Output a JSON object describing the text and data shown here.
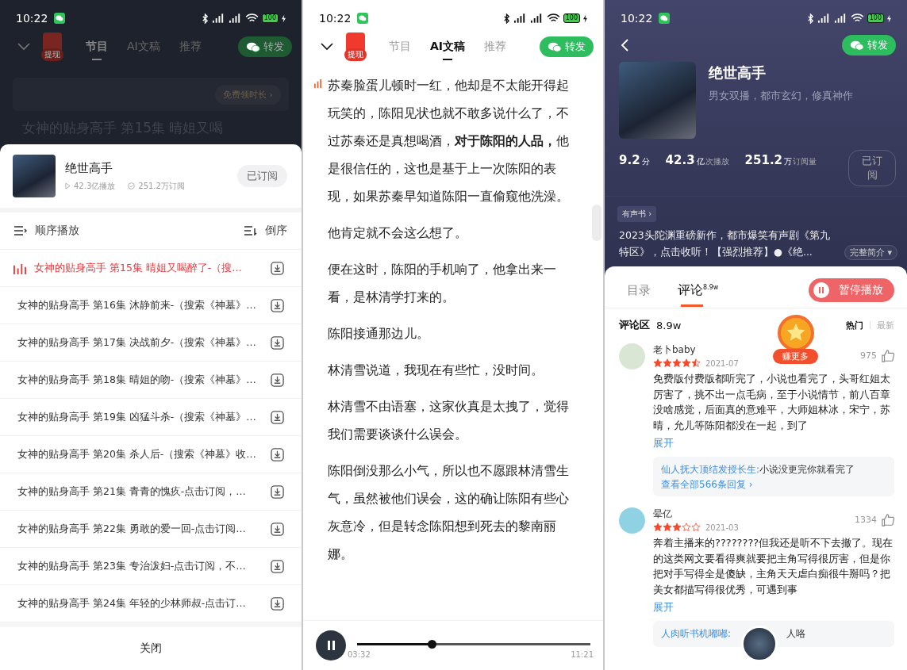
{
  "playlist_screen": {
    "status_bar": {
      "time": "10:22",
      "battery": "100"
    },
    "top_bar": {
      "badge": "提现",
      "tabs": [
        {
          "label": "节目",
          "selected": true
        },
        {
          "label": "AI文稿",
          "selected": false
        },
        {
          "label": "推荐",
          "selected": false
        }
      ],
      "share": "转发"
    },
    "backdrop": {
      "free_time_button": "免费领时长 ›",
      "episode_title": "女神的贴身高手 第15集 晴姐又喝"
    },
    "album": {
      "title": "绝世高手",
      "plays": "42.3亿播放",
      "subscriptions": "251.2万订阅",
      "subscribe_button": "已订阅",
      "subscribed": true
    },
    "sort": {
      "order": "顺序播放",
      "reverse": "倒序"
    },
    "episodes": [
      {
        "title": "女神的贴身高手 第15集 晴姐又喝醉了-（搜…",
        "playing": true
      },
      {
        "title": "女神的贴身高手 第16集 沐静前来-（搜索《神墓》…",
        "playing": false
      },
      {
        "title": "女神的贴身高手 第17集 决战前夕-（搜索《神墓》…",
        "playing": false
      },
      {
        "title": "女神的贴身高手 第18集 晴姐的吻-（搜索《神墓》…",
        "playing": false
      },
      {
        "title": "女神的贴身高手 第19集 凶猛斗杀-（搜索《神墓》…",
        "playing": false
      },
      {
        "title": "女神的贴身高手 第20集 杀人后-（搜索《神墓》收…",
        "playing": false
      },
      {
        "title": "女神的贴身高手 第21集 青青的愧疚-点击订阅，…",
        "playing": false
      },
      {
        "title": "女神的贴身高手 第22集 勇敢的爱一回-点击订阅…",
        "playing": false
      },
      {
        "title": "女神的贴身高手 第23集 专治泼妇-点击订阅，不…",
        "playing": false
      },
      {
        "title": "女神的贴身高手 第24集 年轻的少林师叔-点击订…",
        "playing": false
      }
    ],
    "close_button": "关闭"
  },
  "transcript_screen": {
    "status_bar": {
      "time": "10:22",
      "battery": "100"
    },
    "top_bar": {
      "badge": "提现",
      "tabs": [
        {
          "label": "节目",
          "selected": false
        },
        {
          "label": "AI文稿",
          "selected": true
        },
        {
          "label": "推荐",
          "selected": false
        }
      ],
      "share": "转发"
    },
    "paragraphs": [
      {
        "text": "苏秦脸蛋儿顿时一红，他却是不太能开得起玩笑的，陈阳见状也就不敢多说什么了，不过苏秦还是真想喝酒，**对于陈阳的人品，**他是很信任的，这也是基于上一次陈阳的表现，如果苏秦早知道陈阳一直偷窥他洗澡。",
        "playing": true
      },
      {
        "text": "他肯定就不会这么想了。",
        "playing": false
      },
      {
        "text": "便在这时，陈阳的手机响了，他拿出来一看，是林清学打来的。",
        "playing": false
      },
      {
        "text": "陈阳接通那边儿。",
        "playing": false
      },
      {
        "text": "林清雪说道，我现在有些忙，没时间。",
        "playing": false
      },
      {
        "text": "林清雪不由语塞，这家伙真是太拽了，觉得我们需要谈谈什么误会。",
        "playing": false
      },
      {
        "text": "陈阳倒没那么小气，所以也不愿跟林清雪生气，虽然被他们误会，这的确让陈阳有些心灰意冷，但是转念陈阳想到死去的黎南丽娜。",
        "playing": false
      }
    ],
    "player": {
      "playing": true,
      "level": 0.32,
      "elapsed": "03:32",
      "duration": "11:21"
    }
  },
  "detail_screen": {
    "status_bar": {
      "time": "10:22",
      "battery": "100"
    },
    "share": "转发",
    "album": {
      "title": "绝世高手",
      "tags": "男女双播，都市玄幻，修真神作"
    },
    "stats": [
      {
        "value": "9.2",
        "unit": "分"
      },
      {
        "value": "42.3",
        "unit": "亿",
        "label": "次播放"
      },
      {
        "value": "251.2",
        "unit": "万",
        "label": "订阅量"
      }
    ],
    "subscribe_button": "已订阅",
    "category": "有声书 ›",
    "intro": "2023头陀渊重磅新作，都市爆笑有声剧《第九特区》，点击收听！【强烈推荐】●《绝...",
    "intro_more": "完整简介 ▾",
    "tabs": [
      {
        "label": "目录",
        "selected": false
      },
      {
        "label": "评论",
        "count": "8.9w",
        "selected": true
      }
    ],
    "pause_button": "暂停播放",
    "comments_header": {
      "title": "评论区",
      "count": "8.9w",
      "sort": [
        {
          "label": "热门",
          "selected": true
        },
        {
          "label": "最新",
          "selected": false
        }
      ]
    },
    "reward_button": "赚更多",
    "comments": [
      {
        "user": "老卜baby",
        "stars": 4.5,
        "date": "2021-07",
        "likes": "975",
        "text": "免费版付费版都听完了，小说也看完了，头哥红姐太厉害了，挑不出一点毛病，至于小说情节，前八百章没啥感觉，后面真的意难平，大师姐林冰，宋宁，苏晴，允儿等陈阳都没在一起，到了",
        "expand": "展开",
        "reply": {
          "author": "仙人抚大顶结发授长生:",
          "text": "小说没更完你就看完了",
          "more": "查看全部566条回复 ›"
        }
      },
      {
        "user": "晕亿",
        "stars": 3,
        "date": "2021-03",
        "likes": "1334",
        "text": "奔着主播来的????????但我还是听不下去撤了。现在的这类网文要看得爽就要把主角写得很厉害，但是你把对手写得全是傻缺，主角天天虐白痴很牛掰吗？把美女都描写得很优秀，可遇到事",
        "expand": "展开",
        "reply": {
          "author": "人肉听书机嘟嘟:",
          "text": "人咯"
        }
      }
    ]
  }
}
